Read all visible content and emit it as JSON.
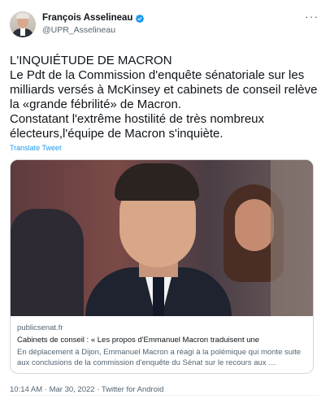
{
  "author": {
    "display_name": "François Asselineau",
    "handle": "@UPR_Asselineau",
    "verified": true,
    "avatar_icon": "profile-photo"
  },
  "menu": {
    "more_label": "···"
  },
  "tweet": {
    "lines": [
      "L'INQUIÉTUDE DE MACRON",
      "Le Pdt de la Commission d'enquête sénatoriale sur les milliards versés à McKinsey et cabinets de conseil relève la «grande fébrilité» de Macron.",
      "Constatant l'extrême hostilité de très nombreux électeurs,l'équipe de Macron s'inquiète."
    ],
    "translate_label": "Translate Tweet"
  },
  "card": {
    "domain": "publicsenat.fr",
    "title": "Cabinets de conseil : « Les propos d'Emmanuel Macron traduisent une",
    "description": "En déplacement à Dijon, Emmanuel Macron a réagi à la polémique qui monte suite aux conclusions de la commission d'enquête du Sénat sur le recours aux …"
  },
  "meta": {
    "timestamp": "10:14 AM · Mar 30, 2022 · Twitter for Android"
  },
  "colors": {
    "accent": "#1d9bf0",
    "text": "#0f1419",
    "secondary": "#536471",
    "border": "#cfd9de"
  }
}
